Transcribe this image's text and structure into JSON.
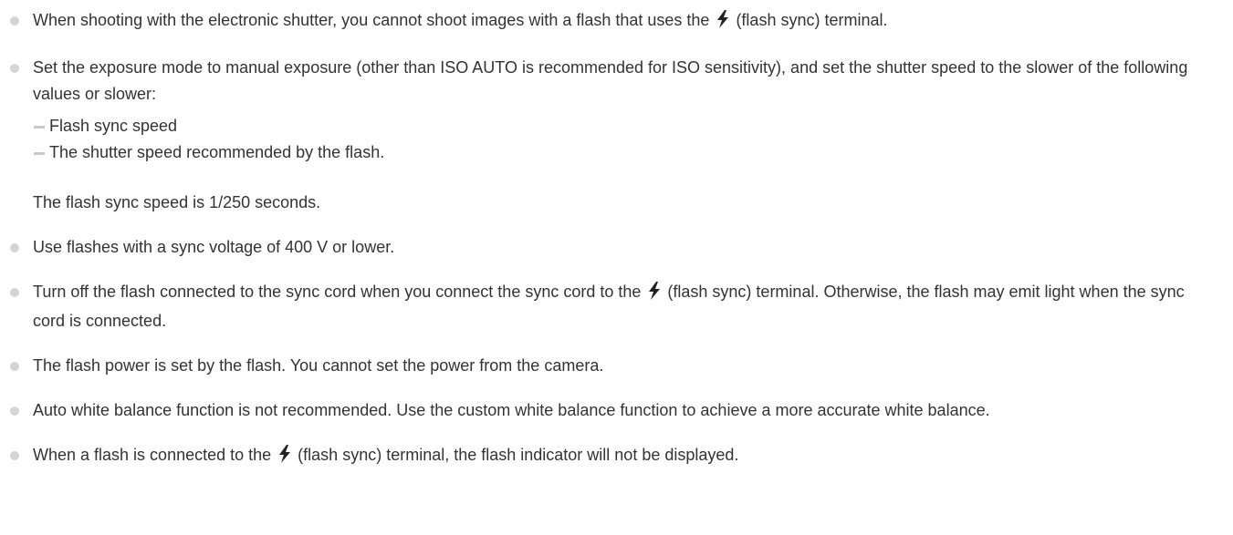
{
  "notes": [
    {
      "before_icon": "When shooting with the electronic shutter, you cannot shoot images with a flash that uses the",
      "icon": "flash-sync-icon",
      "after_icon": "(flash sync) terminal."
    },
    {
      "text": "Set the exposure mode to manual exposure (other than ISO AUTO is recommended for ISO sensitivity), and set the shutter speed to the slower of the following values or slower:",
      "subitems": [
        "Flash sync speed",
        "The shutter speed recommended by the flash."
      ],
      "extra": "The flash sync speed is 1/250 seconds."
    },
    {
      "text": "Use flashes with a sync voltage of 400 V or lower."
    },
    {
      "before_icon": "Turn off the flash connected to the sync cord when you connect the sync cord to the",
      "icon": "flash-sync-icon",
      "after_icon": "(flash sync) terminal. Otherwise, the flash may emit light when the sync cord is connected."
    },
    {
      "text": "The flash power is set by the flash. You cannot set the power from the camera."
    },
    {
      "text": "Auto white balance function is not recommended. Use the custom white balance function to achieve a more accurate white balance."
    },
    {
      "before_icon": "When a flash is connected to the",
      "icon": "flash-sync-icon",
      "after_icon": "(flash sync) terminal, the flash indicator will not be displayed."
    }
  ],
  "colors": {
    "text": "#333333",
    "bullet": "#d4d4d4",
    "icon": "#222222"
  }
}
